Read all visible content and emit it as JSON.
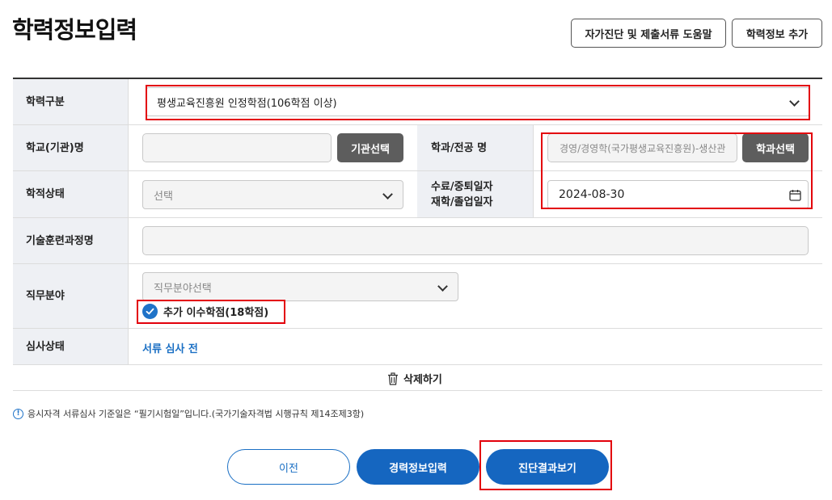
{
  "page": {
    "title": "학력정보입력"
  },
  "header_buttons": {
    "help": "자가진단 및 제출서류 도움말",
    "add_education": "학력정보 추가"
  },
  "form": {
    "education_type": {
      "label": "학력구분",
      "value": "평생교육진흥원 인정학점(106학점 이상)"
    },
    "school": {
      "label": "학교(기관)명",
      "value": "",
      "button": "기관선택"
    },
    "major": {
      "label": "학과/전공 명",
      "value": "경영/경영학(국가평생교육진흥원)-생산관",
      "button": "학과선택"
    },
    "enrollment_status": {
      "label": "학적상태",
      "placeholder": "선택"
    },
    "completion_date": {
      "label_line1": "수료/중퇴일자",
      "label_line2": "재학/졸업일자",
      "value": "2024-08-30"
    },
    "training_course": {
      "label": "기술훈련과정명",
      "value": ""
    },
    "job_field": {
      "label": "직무분야",
      "placeholder": "직무분야선택",
      "additional_credit": "추가 이수학점(18학점)",
      "additional_checked": true
    },
    "review_status": {
      "label": "심사상태",
      "value": "서류 심사 전"
    },
    "delete": "삭제하기"
  },
  "notice": "응시자격 서류심사 기준일은 “필기시험일”입니다.(국가기술자격법 시행규칙 제14조제3항)",
  "footer_buttons": {
    "prev": "이전",
    "career": "경력정보입력",
    "result": "진단결과보기"
  },
  "colors": {
    "accent": "#1566c0",
    "highlight": "#e3000b",
    "label_bg": "#eef0f4",
    "button_gray": "#5d5d5d"
  }
}
